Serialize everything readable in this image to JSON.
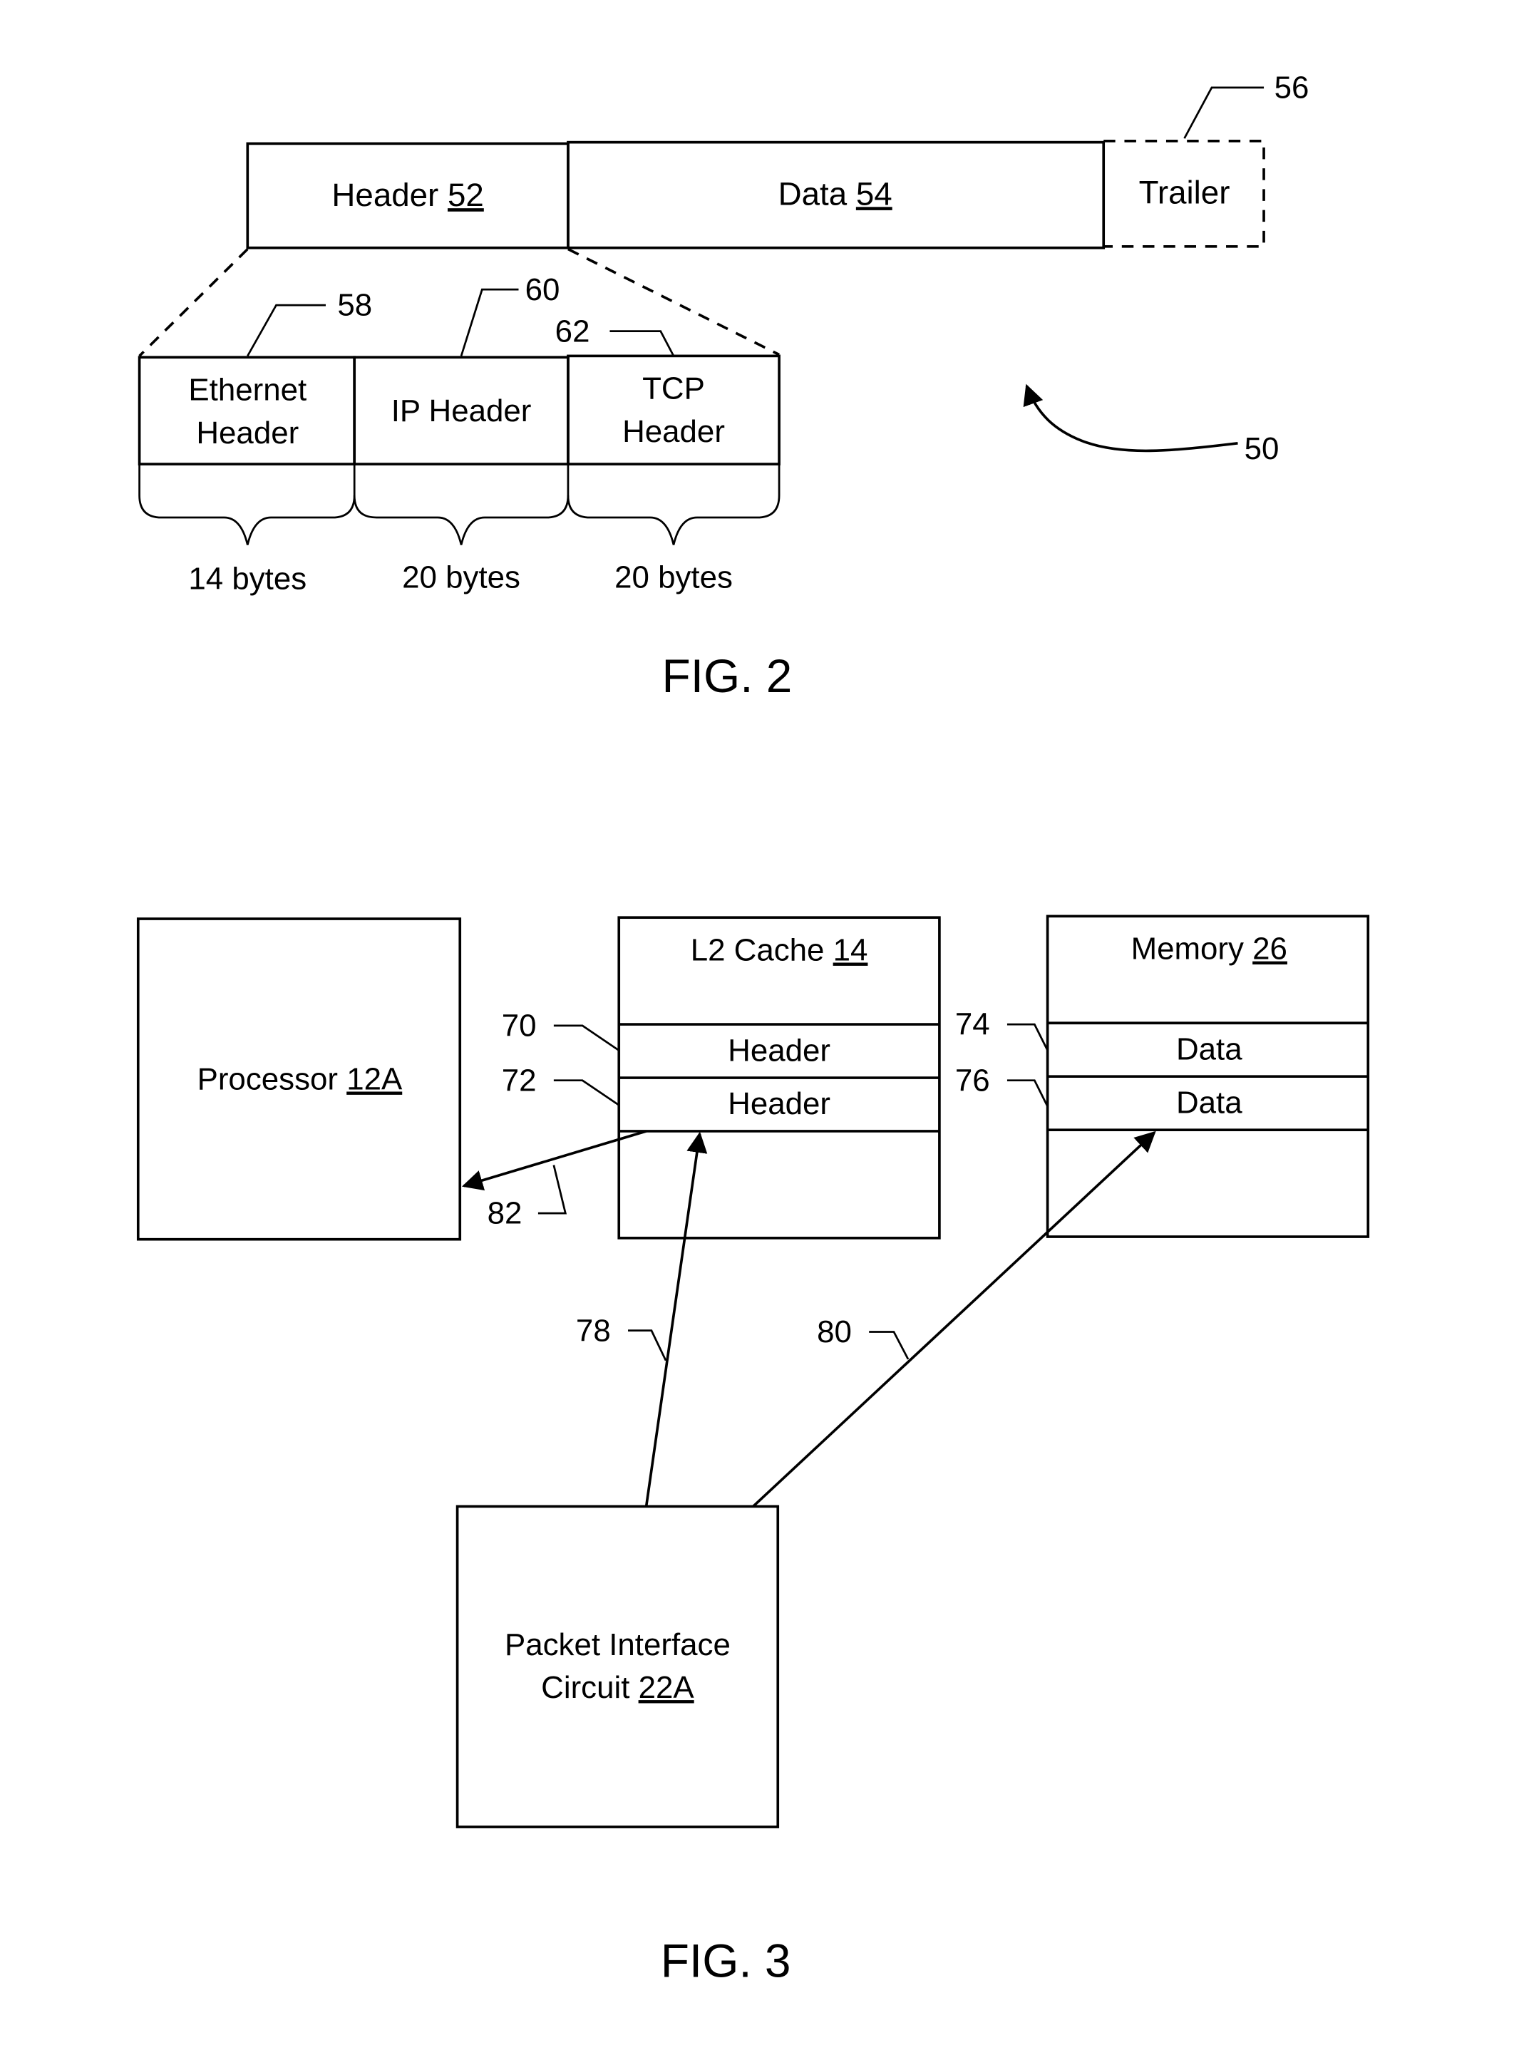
{
  "fig2": {
    "caption": "FIG. 2",
    "packet": {
      "header_label": "Header",
      "header_ref": "52",
      "data_label": "Data",
      "data_ref": "54",
      "trailer_label": "Trailer",
      "trailer_ref": "56"
    },
    "sub_headers": [
      {
        "line1": "Ethernet",
        "line2": "Header",
        "ref": "58",
        "size": "14 bytes"
      },
      {
        "line1": "IP Header",
        "line2": "",
        "ref": "60",
        "size": "20 bytes"
      },
      {
        "line1": "TCP",
        "line2": "Header",
        "ref": "62",
        "size": "20 bytes"
      }
    ],
    "packet_ref": "50"
  },
  "fig3": {
    "caption": "FIG. 3",
    "processor": {
      "label": "Processor",
      "ref": "12A"
    },
    "l2_cache": {
      "label": "L2 Cache",
      "ref": "14",
      "rows": [
        "Header",
        "Header"
      ],
      "row_refs": [
        "70",
        "72"
      ]
    },
    "memory": {
      "label": "Memory",
      "ref": "26",
      "rows": [
        "Data",
        "Data"
      ],
      "row_refs": [
        "74",
        "76"
      ]
    },
    "packet_interface": {
      "line1": "Packet Interface",
      "line2": "Circuit",
      "ref": "22A"
    },
    "arrow_refs": {
      "to_cache": "78",
      "to_memory": "80",
      "to_processor": "82"
    }
  }
}
